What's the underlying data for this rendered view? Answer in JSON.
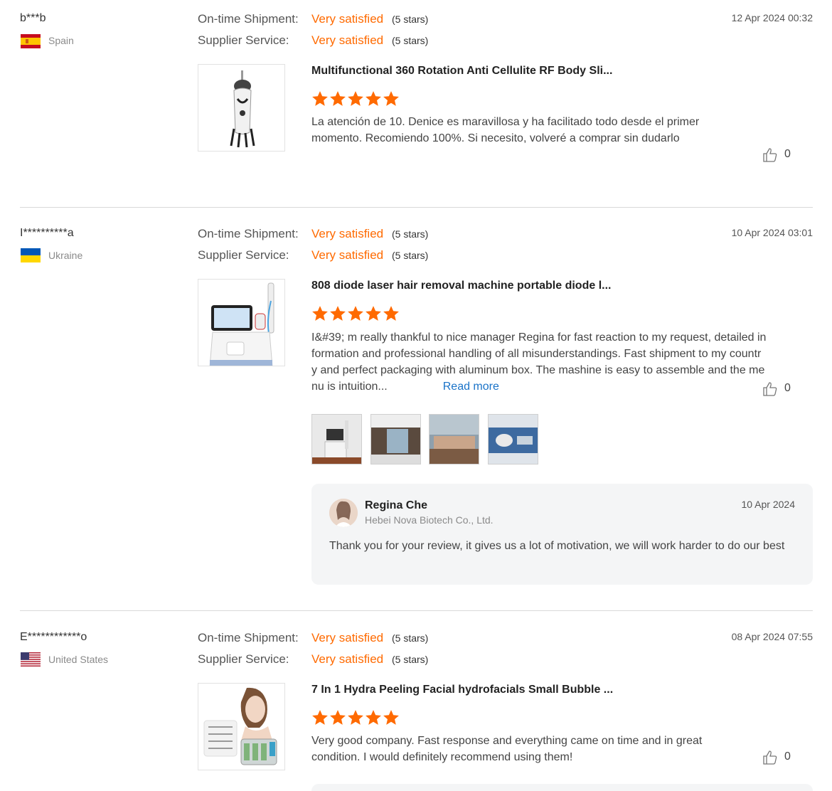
{
  "labels": {
    "ontime": "On-time Shipment:",
    "supplier": "Supplier Service:",
    "read_more": "Read more"
  },
  "colors": {
    "accent": "#ff6a00",
    "link": "#1a73c8"
  },
  "reviews": [
    {
      "user": "b***b",
      "country": "Spain",
      "flag": "spain-flag",
      "date": "12 Apr 2024 00:32",
      "ontime_rating": "Very satisfied",
      "ontime_stars": "(5 stars)",
      "supplier_rating": "Very satisfied",
      "supplier_stars": "(5 stars)",
      "product_title": "Multifunctional 360 Rotation Anti Cellulite RF Body Sli...",
      "rating": 5,
      "text": "La atención de 10. Denice es maravillosa y ha facilitado todo desde el primer momento. Recomiendo 100%. Si necesito, volveré a comprar sin dudarlo",
      "likes": "0"
    },
    {
      "user": "I**********a",
      "country": "Ukraine",
      "flag": "ukraine-flag",
      "date": "10 Apr 2024 03:01",
      "ontime_rating": "Very satisfied",
      "ontime_stars": "(5 stars)",
      "supplier_rating": "Very satisfied",
      "supplier_stars": "(5 stars)",
      "product_title": "808 diode laser hair removal machine portable diode l...",
      "rating": 5,
      "text": "I&#39; m really thankful to nice manager Regina for fast reaction to my request, detailed information and professional handling of all misunderstandings. Fast shipment to my country and perfect packaging with aluminum box. The mashine is easy to assemble and the menu is intuition...",
      "likes": "0",
      "reply": {
        "name": "Regina Che",
        "company": "Hebei Nova Biotech Co., Ltd.",
        "date": "10 Apr 2024",
        "text": "Thank you for your review, it gives us a lot of motivation, we will work harder to do our best"
      }
    },
    {
      "user": "E************o",
      "country": "United States",
      "flag": "usa-flag",
      "date": "08 Apr 2024 07:55",
      "ontime_rating": "Very satisfied",
      "ontime_stars": "(5 stars)",
      "supplier_rating": "Very satisfied",
      "supplier_stars": "(5 stars)",
      "product_title": "7 In 1 Hydra Peeling Facial hydrofacials Small Bubble ...",
      "rating": 5,
      "text": "Very good company. Fast response and everything came on time and in great condition. I would definitely recommend using them!",
      "likes": "0"
    }
  ]
}
